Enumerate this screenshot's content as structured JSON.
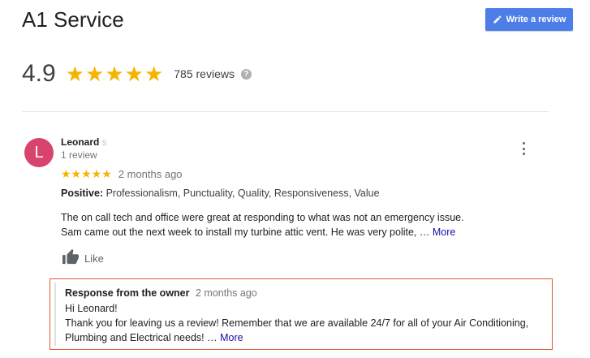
{
  "business": {
    "name": "A1 Service",
    "write_review_label": "Write a review",
    "rating": "4.9",
    "stars": "★★★★★",
    "review_count": "785 reviews",
    "help_glyph": "?"
  },
  "review": {
    "avatar_letter": "L",
    "avatar_color": "#d8446c",
    "reviewer_name": "Leonard",
    "reviewer_suffix": "S",
    "reviewer_meta": "1 review",
    "stars": "★★★★★",
    "date": "2 months ago",
    "positive_label": "Positive:",
    "positive_values": "Professionalism, Punctuality, Quality, Responsiveness, Value",
    "text_line1": "The on call tech and office were great at responding to what was not an emergency issue.",
    "text_line2": "Sam came out the next week to install my turbine attic vent. He was very polite, …",
    "more_label": "More",
    "like_label": "Like"
  },
  "owner_response": {
    "heading": "Response from the owner",
    "date": "2 months ago",
    "greeting": "Hi Leonard!",
    "text_line1": "Thank you for leaving us a review! Remember that we are available 24/7 for all of your Air Conditioning,",
    "text_line2": "Plumbing and Electrical needs! …",
    "more_label": "More",
    "highlight_color": "#e05a2b"
  },
  "colors": {
    "accent": "#4d7ee8",
    "star": "#f4b400",
    "link": "#1a0dab"
  }
}
